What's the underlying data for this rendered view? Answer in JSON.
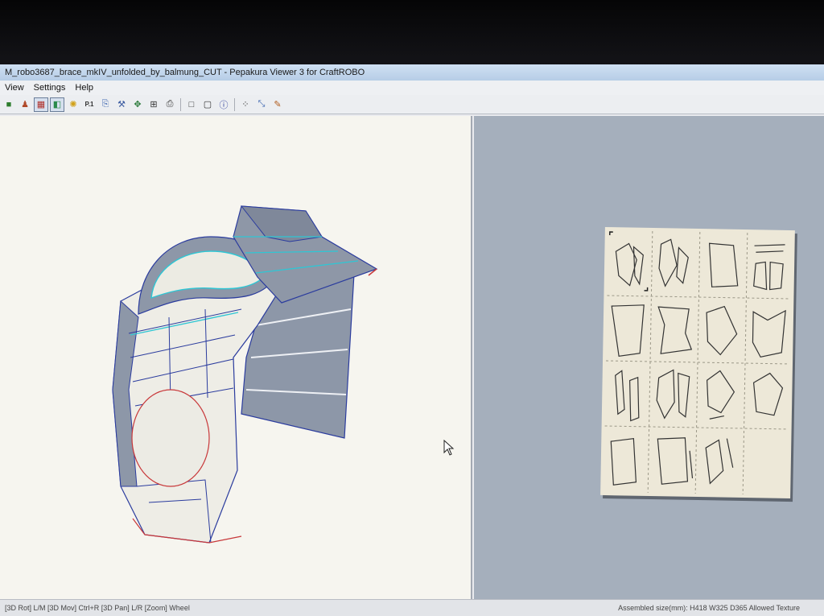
{
  "window": {
    "title": "M_robo3687_brace_mkIV_unfolded_by_balmung_CUT - Pepakura Viewer 3 for CraftROBO"
  },
  "menu": {
    "items": [
      {
        "label": "View"
      },
      {
        "label": "Settings"
      },
      {
        "label": "Help"
      }
    ]
  },
  "toolbar": {
    "buttons": [
      {
        "icon": "cube-icon",
        "glyph": "■",
        "active": false
      },
      {
        "icon": "stamp-icon",
        "glyph": "♟",
        "active": false
      },
      {
        "icon": "view-3d-icon",
        "glyph": "▦",
        "active": true
      },
      {
        "icon": "texture-icon",
        "glyph": "◧",
        "active": true
      },
      {
        "icon": "light-bulb-icon",
        "glyph": "✺",
        "active": false
      },
      {
        "icon": "page-p1-icon",
        "glyph": "P.1",
        "active": false
      },
      {
        "icon": "export-icon",
        "glyph": "⎘",
        "active": false
      },
      {
        "icon": "wrench-icon",
        "glyph": "⚒",
        "active": false
      },
      {
        "icon": "move-icon",
        "glyph": "✥",
        "active": false
      },
      {
        "icon": "paint-icon",
        "glyph": "⊞",
        "active": false
      },
      {
        "icon": "print-icon",
        "glyph": "⎙",
        "active": false
      },
      {
        "icon": "single-view-icon",
        "glyph": "□",
        "active": false
      },
      {
        "icon": "dual-view-icon",
        "glyph": "▢",
        "active": false
      },
      {
        "icon": "info-icon",
        "glyph": "ⓘ",
        "active": false
      },
      {
        "icon": "select-icon",
        "glyph": "⁘",
        "active": false
      },
      {
        "icon": "join-icon",
        "glyph": "⤡",
        "active": false
      },
      {
        "icon": "pencil-icon",
        "glyph": "✎",
        "active": false
      }
    ]
  },
  "status": {
    "left": "[3D Rot] L/M [3D Mov] Ctrl+R [3D Pan] L/R [Zoom] Wheel",
    "right": "Assembled size(mm): H418 W325 D365 Allowed Texture"
  },
  "colors": {
    "model_face": "#8e97a7",
    "model_light": "#ecebe4",
    "edge_blue": "#2b3c9e",
    "edge_cyan": "#2fc6d4",
    "cut_red": "#c8383a"
  }
}
